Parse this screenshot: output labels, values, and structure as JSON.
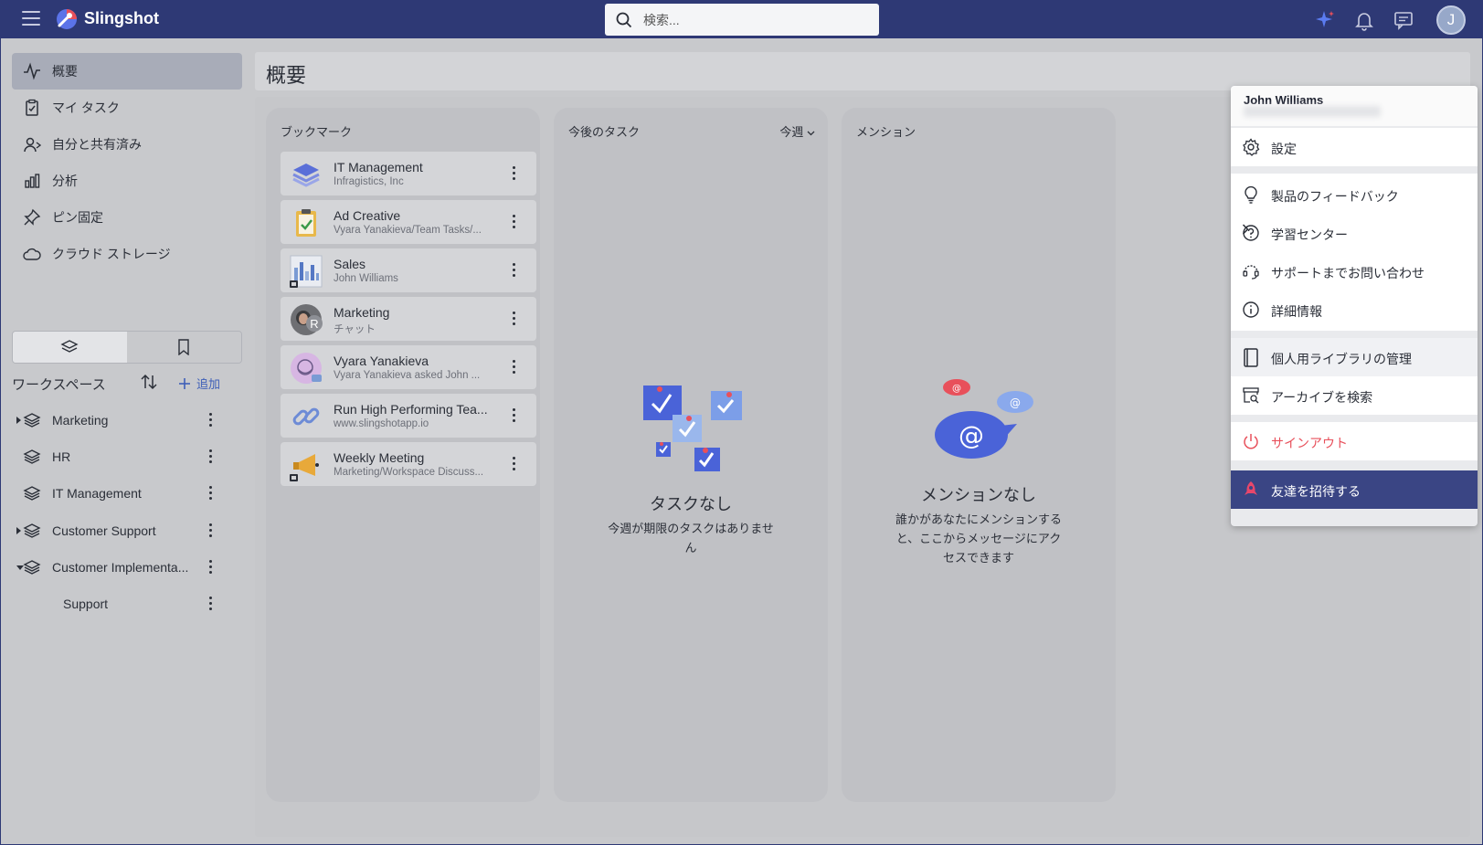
{
  "app": {
    "brand": "Slingshot",
    "user_initial": "J"
  },
  "search": {
    "placeholder": "検索..."
  },
  "colors": {
    "topbar": "#2e3975",
    "accent": "#3e5fb8",
    "signout": "#e8505b",
    "invite_bg": "#3a4584"
  },
  "sidebar": {
    "nav": [
      {
        "label": "概要",
        "icon": "activity-icon",
        "active": true
      },
      {
        "label": "マイ タスク",
        "icon": "clipboard-check-icon"
      },
      {
        "label": "自分と共有済み",
        "icon": "shared-user-icon"
      },
      {
        "label": "分析",
        "icon": "bar-chart-icon"
      },
      {
        "label": "ピン固定",
        "icon": "pin-icon"
      },
      {
        "label": "クラウド ストレージ",
        "icon": "cloud-icon"
      }
    ],
    "workspace_title": "ワークスペース",
    "add_label": "追加",
    "workspaces": [
      {
        "label": "Marketing",
        "caret": "right"
      },
      {
        "label": "HR",
        "caret": "none"
      },
      {
        "label": "IT Management",
        "caret": "none"
      },
      {
        "label": "Customer Support",
        "caret": "right"
      },
      {
        "label": "Customer Implementa...",
        "caret": "down"
      },
      {
        "label": "Support",
        "caret": "child"
      }
    ]
  },
  "main": {
    "title": "概要",
    "bookmarks": {
      "title": "ブックマーク",
      "items": [
        {
          "title": "IT Management",
          "subtitle": "Infragistics, Inc",
          "icon": "workspace-stack-icon"
        },
        {
          "title": "Ad Creative",
          "subtitle": "Vyara Yanakieva/Team Tasks/...",
          "icon": "task-clipboard-icon"
        },
        {
          "title": "Sales",
          "subtitle": "John Williams",
          "icon": "dashboard-thumbnail-icon"
        },
        {
          "title": "Marketing",
          "subtitle": "チャット",
          "icon": "chat-avatar-icon"
        },
        {
          "title": "Vyara Yanakieva",
          "subtitle": "Vyara Yanakieva asked John ...",
          "icon": "user-avatar-icon"
        },
        {
          "title": "Run High Performing Tea...",
          "subtitle": "www.slingshotapp.io",
          "icon": "link-icon"
        },
        {
          "title": "Weekly Meeting",
          "subtitle": "Marketing/Workspace Discuss...",
          "icon": "megaphone-icon"
        }
      ]
    },
    "tasks": {
      "title": "今後のタスク",
      "filter": "今週",
      "empty_title": "タスクなし",
      "empty_desc_1": "今週が期限のタスクはありませ",
      "empty_desc_2": "ん"
    },
    "mentions": {
      "title": "メンション",
      "empty_title": "メンションなし",
      "empty_desc_1": "誰かがあなたにメンションする",
      "empty_desc_2": "と、ここからメッセージにアク",
      "empty_desc_3": "セスできます"
    }
  },
  "user_menu": {
    "name": "John Williams",
    "settings": "設定",
    "feedback": "製品のフィードバック",
    "learning": "学習センター",
    "support": "サポートまでお問い合わせ",
    "about": "詳細情報",
    "library": "個人用ライブラリの管理",
    "archive": "アーカイブを検索",
    "signout": "サインアウト",
    "invite": "友達を招待する"
  }
}
